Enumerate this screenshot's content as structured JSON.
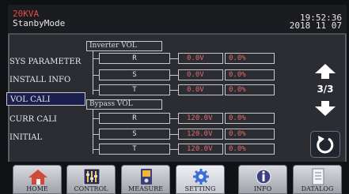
{
  "header": {
    "rating": "20KVA",
    "mode": "StanbyMode",
    "time": "19:52:36",
    "date": "2018 11 07"
  },
  "menu": {
    "items": [
      {
        "label": "SYS PARAMETER"
      },
      {
        "label": "INSTALL INFO"
      },
      {
        "label": "VOL CALI",
        "selected": true
      },
      {
        "label": "CURR CALI"
      },
      {
        "label": "INITIAL"
      }
    ]
  },
  "inverter": {
    "title": "Inverter VOL",
    "rows": [
      {
        "phase": "R",
        "voltage": "0.0V",
        "percent": "0.0%"
      },
      {
        "phase": "S",
        "voltage": "0.0V",
        "percent": "0.0%"
      },
      {
        "phase": "T",
        "voltage": "0.0V",
        "percent": "0.0%"
      }
    ]
  },
  "bypass": {
    "title": "Bypass VOL",
    "rows": [
      {
        "phase": "R",
        "voltage": "120.0V",
        "percent": "0.0%"
      },
      {
        "phase": "S",
        "voltage": "120.0V",
        "percent": "0.0%"
      },
      {
        "phase": "T",
        "voltage": "120.0V",
        "percent": "0.0%"
      }
    ]
  },
  "pager": {
    "page": "3/3"
  },
  "nav": {
    "tabs": [
      {
        "label": "HOME",
        "icon": "home-icon"
      },
      {
        "label": "CONTROL",
        "icon": "control-sliders-icon"
      },
      {
        "label": "MEASURE",
        "icon": "measure-meter-icon"
      },
      {
        "label": "SETTING",
        "icon": "gear-icon",
        "active": true
      },
      {
        "label": "INFO",
        "icon": "info-icon"
      },
      {
        "label": "DATALOG",
        "icon": "datalog-icon"
      }
    ]
  },
  "colors": {
    "header_text": "#e64a4a",
    "value_text": "#e06a6a",
    "selected_bg": "#1a1f4e",
    "tab_bg": "#c9cbd1"
  }
}
